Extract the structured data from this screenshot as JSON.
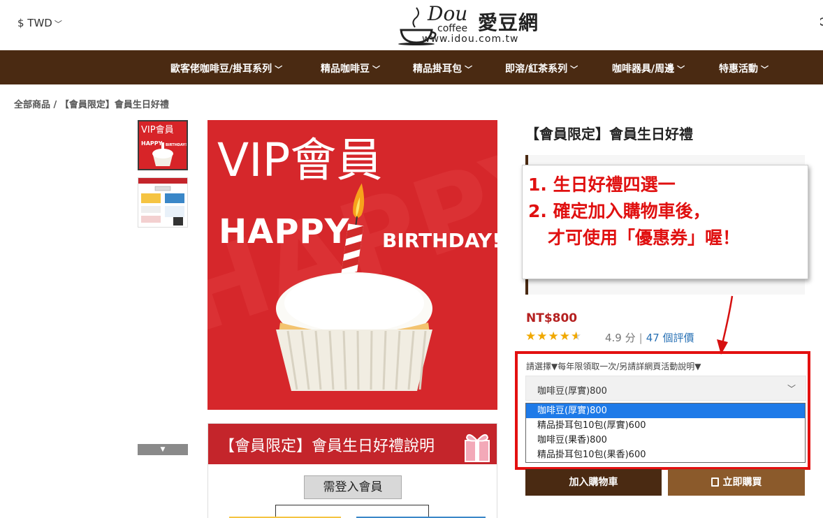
{
  "header": {
    "currency": "$ TWD",
    "logo": {
      "brand": "Dou",
      "sub": "coffee",
      "cn": "愛豆網",
      "url": "www.idou.com.tw"
    }
  },
  "nav": {
    "items": [
      {
        "label": "歐客佬咖啡豆/掛耳系列"
      },
      {
        "label": "精品咖啡豆"
      },
      {
        "label": "精品掛耳包"
      },
      {
        "label": "即溶/紅茶系列"
      },
      {
        "label": "咖啡器具/周邊"
      },
      {
        "label": "特惠活動"
      }
    ]
  },
  "breadcrumb": {
    "root": "全部商品",
    "separator": "/",
    "current": "【會員限定】會員生日好禮"
  },
  "gallery": {
    "main": {
      "line1": "VIP會員",
      "line2": "HAPPY",
      "line3": "BIRTHDAY!"
    },
    "second": {
      "banner": "【會員限定】會員生日好禮說明",
      "box": "需登入會員"
    }
  },
  "product": {
    "title": "【會員限定】會員生日好禮",
    "note": {
      "line1": "1. 生日好禮四選一",
      "line2": "2. 確定加入購物車後，",
      "line3": "才可使用「優惠券」喔！"
    },
    "price": "NT$800",
    "rating": {
      "score": 4.9,
      "score_text": "4.9 分",
      "reviews": "47 個評價"
    },
    "option_label": "請選擇▼每年限領取一次/另請詳網頁活動說明▼",
    "select": {
      "value": "咖啡豆(厚實)800",
      "options": [
        "咖啡豆(厚實)800",
        "精品掛耳包10包(厚實)600",
        "咖啡豆(果香)800",
        "精品掛耳包10包(果香)600"
      ],
      "highlighted_index": 0
    },
    "buttons": {
      "add_to_cart": "加入購物車",
      "buy_now": "立即購買"
    }
  },
  "colors": {
    "nav_bg": "#4a2a12",
    "accent_red": "#e31010",
    "price": "#b52020",
    "buy_button": "#8b5a2b",
    "highlight": "#1e7ae8"
  }
}
